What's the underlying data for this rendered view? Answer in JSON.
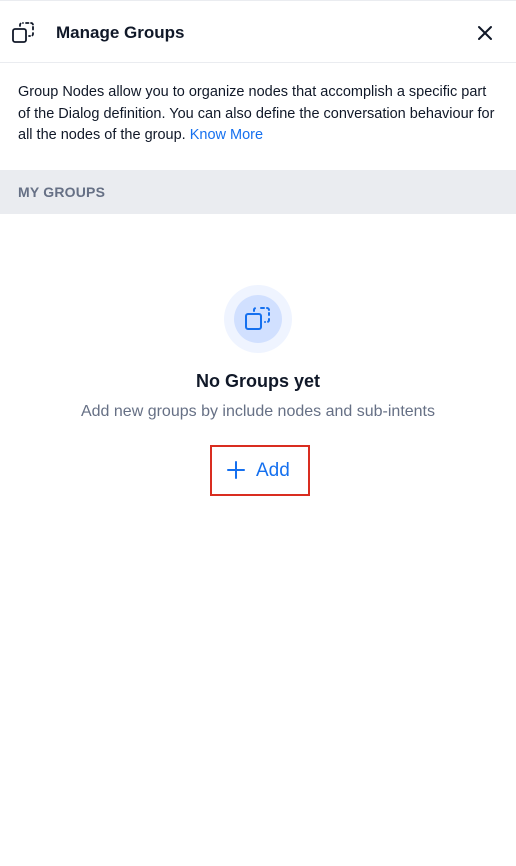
{
  "header": {
    "title": "Manage Groups",
    "icon": "group-nodes-icon",
    "close_icon": "close-icon"
  },
  "description": {
    "text": "Group Nodes allow you to organize nodes that accomplish a specific part of the Dialog definition. You can also define the conversation behaviour for all the nodes of the group. ",
    "link_label": "Know More"
  },
  "section": {
    "label": "MY GROUPS"
  },
  "empty_state": {
    "icon": "group-nodes-icon",
    "title": "No Groups yet",
    "subtitle": "Add new groups by include nodes and sub-intents",
    "add_label": "Add",
    "add_icon": "plus-icon"
  },
  "colors": {
    "accent": "#1570ef",
    "highlight_border": "#d92d20",
    "section_bg": "#eaecf0",
    "muted_text": "#667085"
  }
}
